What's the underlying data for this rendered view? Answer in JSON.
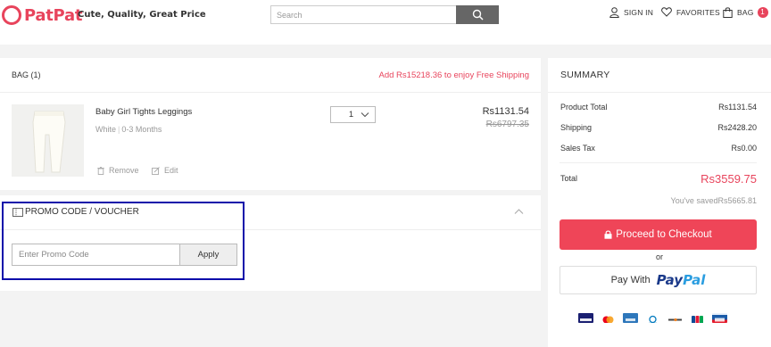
{
  "brand": {
    "name": "PatPat",
    "tagline": "Cute, Quality, Great Price",
    "accent": "#e8445c"
  },
  "search": {
    "placeholder": "Search"
  },
  "nav": {
    "sign_in": "SIGN IN",
    "favorites": "FAVORITES",
    "bag": "BAG",
    "bag_count": "1"
  },
  "bag": {
    "title": "BAG (1)",
    "free_shipping": "Add Rs15218.36 to enjoy Free Shipping",
    "item": {
      "name": "Baby Girl Tights Leggings",
      "color": "White",
      "size": "0-3 Months",
      "quantity": "1",
      "price": "Rs1131.54",
      "original_price": "Rs6797.35",
      "remove_label": "Remove",
      "edit_label": "Edit"
    }
  },
  "promo": {
    "title": "PROMO CODE / VOUCHER",
    "placeholder": "Enter Promo Code",
    "apply_label": "Apply"
  },
  "summary": {
    "title": "SUMMARY",
    "rows": [
      {
        "label": "Product Total",
        "value": "Rs1131.54"
      },
      {
        "label": "Shipping",
        "value": "Rs2428.20"
      },
      {
        "label": "Sales Tax",
        "value": "Rs0.00"
      }
    ],
    "total_label": "Total",
    "total_value": "Rs3559.75",
    "saved": "You've savedRs5665.81",
    "checkout_label": "Proceed to Checkout",
    "or": "or",
    "paypal_prefix": "Pay With",
    "paypal_logo_a": "Pay",
    "paypal_logo_b": "Pal",
    "payment_icons": [
      "visa-icon",
      "mastercard-icon",
      "amex-icon",
      "diners-icon",
      "discover-icon",
      "jcb-icon",
      "maestro-icon"
    ]
  },
  "colors": {
    "checkout": "#ef4558",
    "paypal_dark": "#1b3a8a",
    "paypal_light": "#2a9de0",
    "highlight": "#0c0caa"
  }
}
